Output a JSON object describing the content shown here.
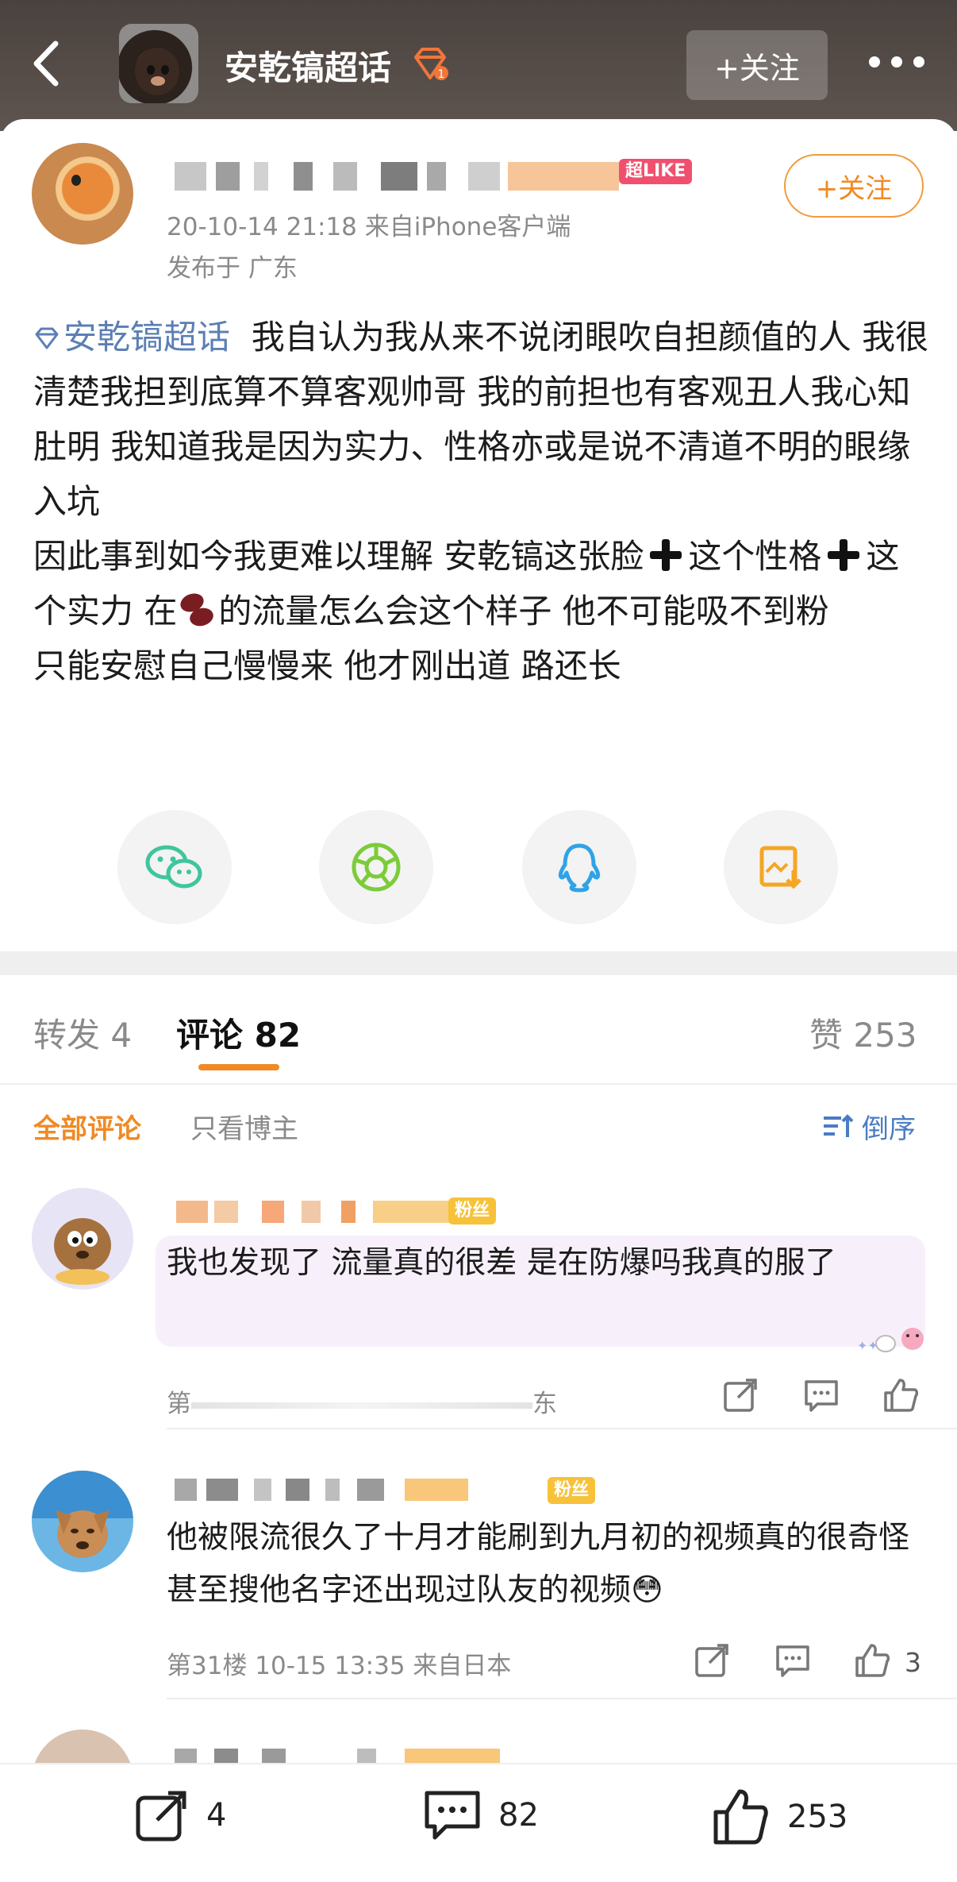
{
  "header": {
    "title": "安乾镐超话",
    "follow_label": "+关注"
  },
  "post": {
    "super_like_badge": "超LIKE",
    "follow_label": "+关注",
    "meta": "20-10-14 21:18  来自iPhone客户端",
    "region": "发布于 广东",
    "topic": "安乾镐超话",
    "lines": [
      "我自认为我从来不说闭眼吹自担颜值的人 我很清楚我担到底算不算客观帅哥 我的前担也有客观丑人我心知肚明 我知道我是因为实力、性格亦或是说不清道不明的眼缘入坑",
      "因此事到如今我更难以理解 安乾镐这张脸",
      "这个性格",
      "这个实力 在",
      "的流量怎么会这个样子 他不可能吸不到粉",
      "只能安慰自己慢慢来 他才刚出道 路还长"
    ]
  },
  "share_icons": [
    "wechat-icon",
    "moments-icon",
    "qq-icon",
    "save-image-icon"
  ],
  "tabs": {
    "repost": "转发 4",
    "comments": "评论 82",
    "likes": "赞 253"
  },
  "filters": {
    "all": "全部评论",
    "author_only": "只看博主",
    "sort": "倒序"
  },
  "comments": [
    {
      "fan_badge": "粉丝",
      "text": "我也发现了 流量真的很差 是在防爆吗我真的服了",
      "meta_prefix": "第",
      "meta_suffix": "东"
    },
    {
      "fan_badge": "粉丝",
      "text": "他被限流很久了十月才能刷到九月初的视频真的很奇怪甚至搜他名字还出现过队友的视频😳",
      "meta": "第31楼  10-15 13:35  来自日本",
      "like_count": "3"
    }
  ],
  "bottom_bar": {
    "repost_count": "4",
    "comment_count": "82",
    "like_count": "253"
  },
  "colors": {
    "accent": "#f08a24",
    "topic_link": "#5b7fb5",
    "sort_link": "#4a7cc3",
    "fan_badge": "#f7c23a",
    "super_like": "#f0506e"
  }
}
